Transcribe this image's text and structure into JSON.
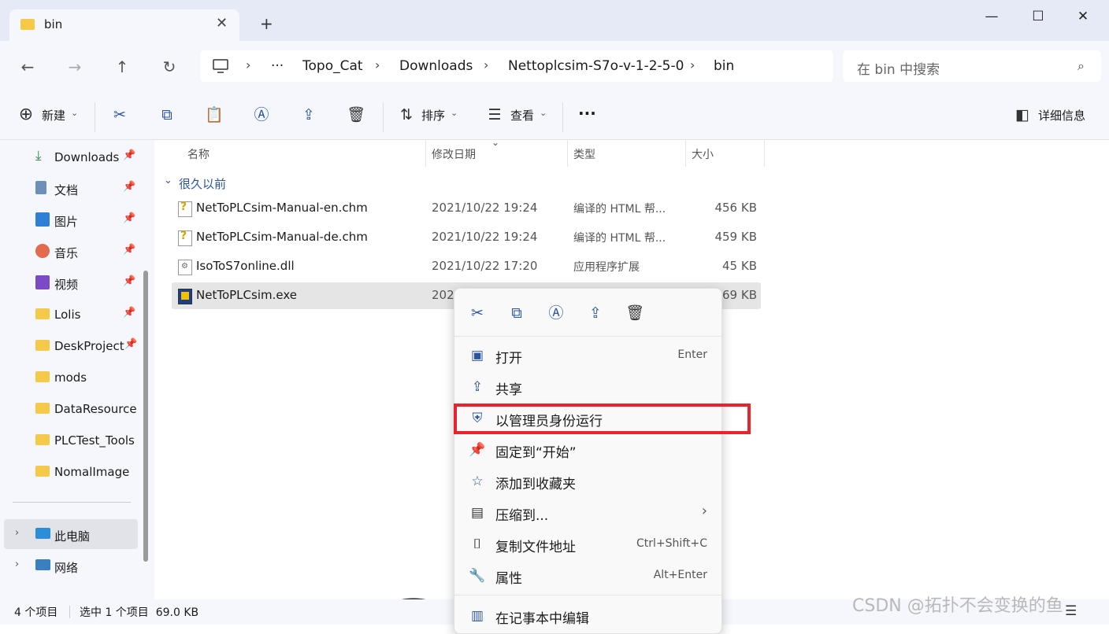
{
  "window": {
    "tab_title": "bin",
    "new_tab": "+",
    "minimize": "—",
    "maximize": "☐",
    "close": "✕"
  },
  "nav": {
    "back": "←",
    "forward": "→",
    "up": "↑",
    "refresh": "↻"
  },
  "breadcrumb": {
    "more": "···",
    "items": [
      "Topo_Cat",
      "Downloads",
      "Nettoplcsim-S7o-v-1-2-5-0",
      "bin"
    ]
  },
  "search": {
    "placeholder": "在 bin 中搜索"
  },
  "toolbar": {
    "new_label": "新建",
    "sort_label": "排序",
    "view_label": "查看",
    "more": "···",
    "details_label": "详细信息"
  },
  "sidebar": {
    "items": [
      {
        "label": "Downloads",
        "pinned": true,
        "icon": "download-icon"
      },
      {
        "label": "文档",
        "pinned": true,
        "icon": "document-icon"
      },
      {
        "label": "图片",
        "pinned": true,
        "icon": "pictures-icon"
      },
      {
        "label": "音乐",
        "pinned": true,
        "icon": "music-icon"
      },
      {
        "label": "视频",
        "pinned": true,
        "icon": "video-icon"
      },
      {
        "label": "Lolis",
        "pinned": true,
        "icon": "folder-icon"
      },
      {
        "label": "DeskProject",
        "pinned": true,
        "icon": "folder-icon"
      },
      {
        "label": "mods",
        "pinned": false,
        "icon": "folder-icon"
      },
      {
        "label": "DataResource",
        "pinned": false,
        "icon": "folder-icon"
      },
      {
        "label": "PLCTest_Tools",
        "pinned": false,
        "icon": "folder-icon"
      },
      {
        "label": "NomalImage",
        "pinned": false,
        "icon": "folder-icon"
      }
    ],
    "this_pc": "此电脑",
    "network": "网络"
  },
  "columns": {
    "name": "名称",
    "date": "修改日期",
    "type": "类型",
    "size": "大小"
  },
  "group_label": "很久以前",
  "files": [
    {
      "name": "NetToPLCsim-Manual-en.chm",
      "date": "2021/10/22 19:24",
      "type": "编译的 HTML 帮...",
      "size": "456 KB"
    },
    {
      "name": "NetToPLCsim-Manual-de.chm",
      "date": "2021/10/22 19:24",
      "type": "编译的 HTML 帮...",
      "size": "459 KB"
    },
    {
      "name": "IsoToS7online.dll",
      "date": "2021/10/22 17:20",
      "type": "应用程序扩展",
      "size": "45 KB"
    },
    {
      "name": "NetToPLCsim.exe",
      "date": "202",
      "type": "",
      "size": "69 KB"
    }
  ],
  "status": {
    "count": "4 个项目",
    "selected": "选中 1 个项目  69.0 KB"
  },
  "context_menu": {
    "items": [
      {
        "label": "打开",
        "shortcut": "Enter"
      },
      {
        "label": "共享",
        "shortcut": ""
      },
      {
        "label": "以管理员身份运行",
        "shortcut": ""
      },
      {
        "label": "固定到“开始”",
        "shortcut": ""
      },
      {
        "label": "添加到收藏夹",
        "shortcut": ""
      },
      {
        "label": "压缩到...",
        "shortcut": "›"
      },
      {
        "label": "复制文件地址",
        "shortcut": "Ctrl+Shift+C"
      },
      {
        "label": "属性",
        "shortcut": "Alt+Enter"
      },
      {
        "label": "在记事本中编辑",
        "shortcut": ""
      }
    ]
  },
  "watermark": "CSDN @拓扑不会变换的鱼"
}
